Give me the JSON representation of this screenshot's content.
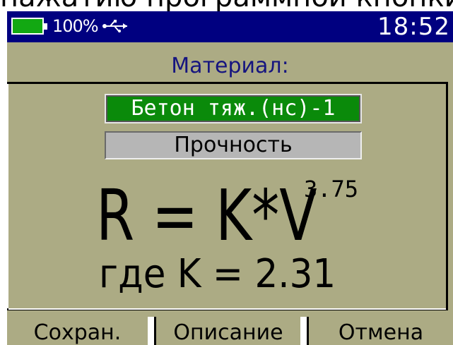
{
  "caption": "нажатию программной кнопки",
  "status": {
    "battery_percent": "100%",
    "battery_level": 1.0,
    "time": "18:52",
    "usb_icon": "usb-icon"
  },
  "screen": {
    "title": "Материал:",
    "material": "Бетон тяж.(нс)-1",
    "parameter": "Прочность",
    "formula": "R = K*V",
    "exponent": "3.75",
    "coefficient_line": "где K = 2.31"
  },
  "softkeys": {
    "save": "Сохран.",
    "description": "Описание",
    "cancel": "Отмена"
  },
  "colors": {
    "background": "#acab84",
    "statusbar": "#000080",
    "title": "#16157f",
    "selected": "#0a8a0a",
    "field": "#b6b6b6"
  }
}
